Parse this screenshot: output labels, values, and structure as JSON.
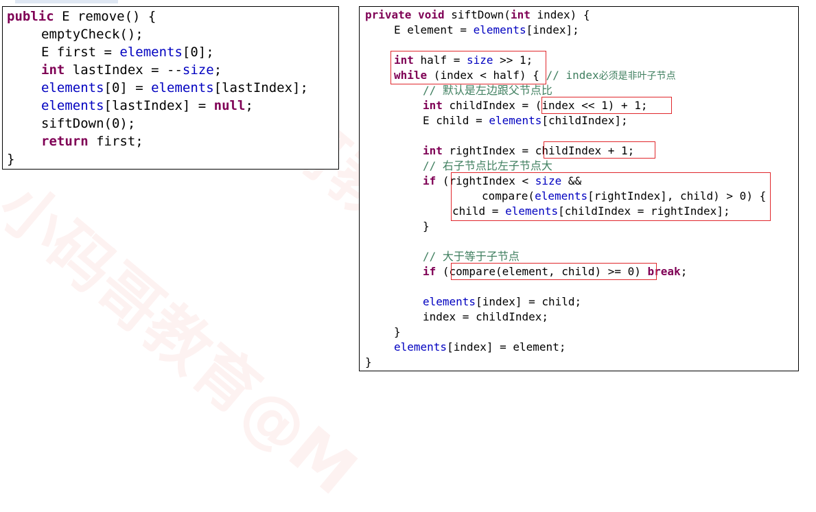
{
  "left_code": {
    "line1": {
      "kw": "public",
      "rest": " E remove() {"
    },
    "line2": "emptyCheck();",
    "line3": {
      "pre": "E first = ",
      "fld": "elements",
      "post": "[0];"
    },
    "line4": {
      "kw": "int",
      "mid": " lastIndex = --",
      "fld": "size",
      "post": ";"
    },
    "line5": {
      "fld1": "elements",
      "mid": "[0] = ",
      "fld2": "elements",
      "post": "[lastIndex];"
    },
    "line6": {
      "fld": "elements",
      "mid": "[lastIndex] = ",
      "kw": "null",
      "post": ";"
    },
    "line7": "siftDown(0);",
    "line8": {
      "kw": "return",
      "post": " first;"
    },
    "line9": "}"
  },
  "right_code": {
    "line1": {
      "kw1": "private",
      "sp1": " ",
      "kw2": "void",
      "mid": " siftDown(",
      "kw3": "int",
      "post": " index) {"
    },
    "line2": {
      "pre": "E element = ",
      "fld": "elements",
      "post": "[index];"
    },
    "line3": {
      "kw": "int",
      "mid": " half = ",
      "fld": "size",
      "post": " >> 1;"
    },
    "line4": {
      "kw": "while",
      "mid": " (index < half) { ",
      "cmt": "// index",
      "cmt_cn": "必须是非叶子节点"
    },
    "line5": {
      "cmt": "// ",
      "cmt_cn": "默认是左边跟父节点比"
    },
    "line6": {
      "kw": "int",
      "post": " childIndex = (index << 1) + 1;"
    },
    "line7": {
      "pre": "E child = ",
      "fld": "elements",
      "post": "[childIndex];"
    },
    "line8": {
      "kw": "int",
      "post": " rightIndex = childIndex + 1;"
    },
    "line9": {
      "cmt": "// ",
      "cmt_cn": "右子节点比左子节点大"
    },
    "line10": {
      "kw": "if",
      "mid": " (rightIndex < ",
      "fld": "size",
      "post": " &&"
    },
    "line11": {
      "pre": "compare(",
      "fld": "elements",
      "post": "[rightIndex], child) > 0) {"
    },
    "line12": {
      "pre": "child = ",
      "fld": "elements",
      "post": "[childIndex = rightIndex];"
    },
    "line13": "}",
    "line14": {
      "cmt": "// ",
      "cmt_cn": "大于等于子节点"
    },
    "line15": {
      "kw1": "if",
      "mid": " (compare(element, child) >= 0) ",
      "kw2": "break",
      "post": ";"
    },
    "line16": {
      "fld": "elements",
      "post": "[index] = child;"
    },
    "line17": "index = childIndex;",
    "line18": "}",
    "line19": {
      "fld": "elements",
      "post": "[index] = element;"
    },
    "line20": "}"
  },
  "watermark": {
    "text": "小码哥教育@M"
  },
  "colors": {
    "keyword": "#7f0055",
    "field": "#0000c0",
    "comment": "#3f7f5f",
    "highlight": "#e0262b",
    "watermark": "#e74c3c"
  }
}
